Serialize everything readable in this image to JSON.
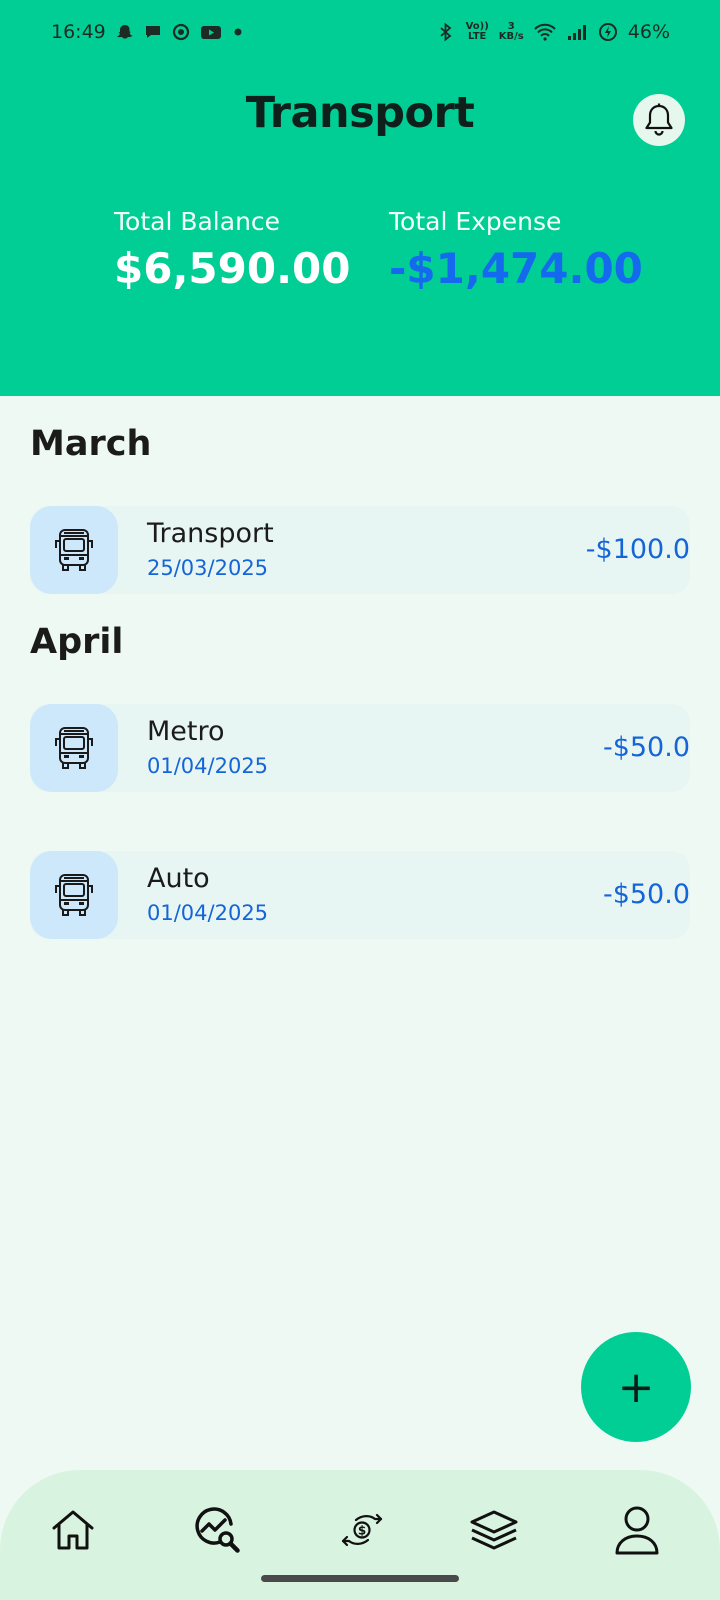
{
  "status_bar": {
    "time": "16:49",
    "left_icons": [
      "snapchat-icon",
      "chat-icon",
      "app-icon",
      "youtube-icon",
      "dot-icon"
    ],
    "network_top": "3",
    "network_bottom": "KB/s",
    "volte_top": "Vo))",
    "volte_bottom": "LTE",
    "battery": "46%"
  },
  "header": {
    "title": "Transport",
    "balance_label": "Total Balance",
    "balance_value": "$6,590.00",
    "expense_label": "Total Expense",
    "expense_value": "-$1,474.00"
  },
  "sections": [
    {
      "month": "March",
      "items": [
        {
          "name": "Transport",
          "date": "25/03/2025",
          "amount": "-$100.0",
          "icon": "bus-icon"
        }
      ]
    },
    {
      "month": "April",
      "items": [
        {
          "name": "Metro",
          "date": "01/04/2025",
          "amount": "-$50.0",
          "icon": "bus-icon"
        },
        {
          "name": "Auto",
          "date": "01/04/2025",
          "amount": "-$50.0",
          "icon": "bus-icon"
        }
      ]
    }
  ],
  "fab": {
    "label": "+"
  },
  "nav": {
    "items": [
      "home-icon",
      "analysis-icon",
      "transactions-icon",
      "categories-icon",
      "profile-icon"
    ]
  },
  "colors": {
    "header": "#00ce94",
    "background": "#edf9f2",
    "accent_blue": "#1565d8",
    "icon_bg": "#cde8fb",
    "nav_bg": "#d8f4e0"
  }
}
